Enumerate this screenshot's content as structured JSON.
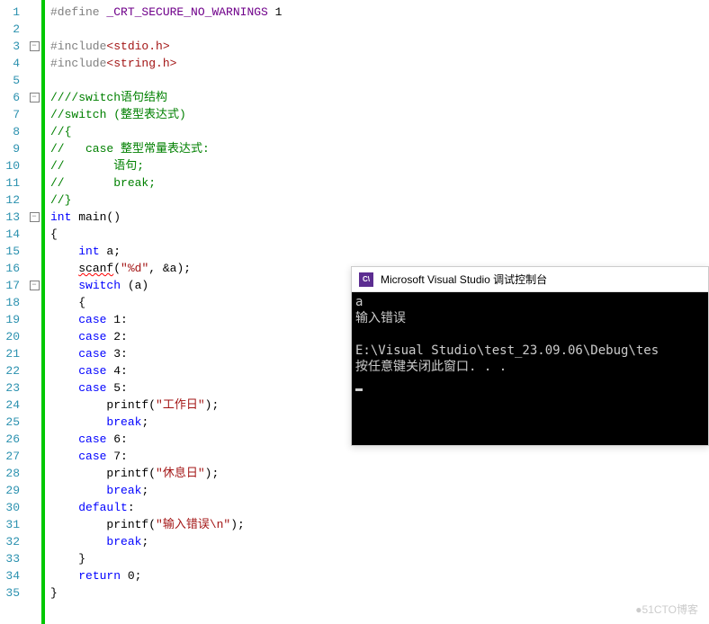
{
  "editor": {
    "lines": [
      {
        "n": 1,
        "fold": "",
        "tokens": [
          {
            "t": "#define ",
            "c": "pp"
          },
          {
            "t": "_CRT_SECURE_NO_WARNINGS",
            "c": "mac"
          },
          {
            "t": " 1",
            "c": "def"
          }
        ]
      },
      {
        "n": 2,
        "fold": "",
        "tokens": []
      },
      {
        "n": 3,
        "fold": "minus",
        "tokens": [
          {
            "t": "#include",
            "c": "pp"
          },
          {
            "t": "<stdio.h>",
            "c": "hdr"
          }
        ]
      },
      {
        "n": 4,
        "fold": "",
        "tokens": [
          {
            "t": "#include",
            "c": "pp"
          },
          {
            "t": "<string.h>",
            "c": "hdr"
          }
        ]
      },
      {
        "n": 5,
        "fold": "",
        "tokens": []
      },
      {
        "n": 6,
        "fold": "minus",
        "tokens": [
          {
            "t": "////switch语句结构",
            "c": "cmt"
          }
        ]
      },
      {
        "n": 7,
        "fold": "",
        "tokens": [
          {
            "t": "//switch (整型表达式)",
            "c": "cmt"
          }
        ]
      },
      {
        "n": 8,
        "fold": "",
        "tokens": [
          {
            "t": "//{",
            "c": "cmt"
          }
        ]
      },
      {
        "n": 9,
        "fold": "",
        "tokens": [
          {
            "t": "//   case 整型常量表达式:",
            "c": "cmt"
          }
        ]
      },
      {
        "n": 10,
        "fold": "",
        "tokens": [
          {
            "t": "//       语句;",
            "c": "cmt"
          }
        ]
      },
      {
        "n": 11,
        "fold": "",
        "tokens": [
          {
            "t": "//       break;",
            "c": "cmt"
          }
        ]
      },
      {
        "n": 12,
        "fold": "",
        "tokens": [
          {
            "t": "//}",
            "c": "cmt"
          }
        ]
      },
      {
        "n": 13,
        "fold": "minus",
        "tokens": [
          {
            "t": "int",
            "c": "kw"
          },
          {
            "t": " main()",
            "c": "fn"
          }
        ]
      },
      {
        "n": 14,
        "fold": "",
        "tokens": [
          {
            "t": "{",
            "c": "def"
          }
        ]
      },
      {
        "n": 15,
        "fold": "",
        "tokens": [
          {
            "t": "    ",
            "c": ""
          },
          {
            "t": "int",
            "c": "kw"
          },
          {
            "t": " a;",
            "c": "def"
          }
        ]
      },
      {
        "n": 16,
        "fold": "",
        "tokens": [
          {
            "t": "    ",
            "c": ""
          },
          {
            "t": "scanf",
            "c": "fn wavy"
          },
          {
            "t": "(",
            "c": "def"
          },
          {
            "t": "\"%d\"",
            "c": "str"
          },
          {
            "t": ", &a);",
            "c": "def"
          }
        ]
      },
      {
        "n": 17,
        "fold": "minus",
        "tokens": [
          {
            "t": "    ",
            "c": ""
          },
          {
            "t": "switch",
            "c": "kw"
          },
          {
            "t": " (a)",
            "c": "def"
          }
        ]
      },
      {
        "n": 18,
        "fold": "",
        "tokens": [
          {
            "t": "    {",
            "c": "def"
          }
        ]
      },
      {
        "n": 19,
        "fold": "",
        "tokens": [
          {
            "t": "    ",
            "c": ""
          },
          {
            "t": "case",
            "c": "kw"
          },
          {
            "t": " 1:",
            "c": "def"
          }
        ]
      },
      {
        "n": 20,
        "fold": "",
        "tokens": [
          {
            "t": "    ",
            "c": ""
          },
          {
            "t": "case",
            "c": "kw"
          },
          {
            "t": " 2:",
            "c": "def"
          }
        ]
      },
      {
        "n": 21,
        "fold": "",
        "tokens": [
          {
            "t": "    ",
            "c": ""
          },
          {
            "t": "case",
            "c": "kw"
          },
          {
            "t": " 3:",
            "c": "def"
          }
        ]
      },
      {
        "n": 22,
        "fold": "",
        "tokens": [
          {
            "t": "    ",
            "c": ""
          },
          {
            "t": "case",
            "c": "kw"
          },
          {
            "t": " 4:",
            "c": "def"
          }
        ]
      },
      {
        "n": 23,
        "fold": "",
        "tokens": [
          {
            "t": "    ",
            "c": ""
          },
          {
            "t": "case",
            "c": "kw"
          },
          {
            "t": " 5:",
            "c": "def"
          }
        ]
      },
      {
        "n": 24,
        "fold": "",
        "tokens": [
          {
            "t": "        printf(",
            "c": "def"
          },
          {
            "t": "\"工作日\"",
            "c": "str"
          },
          {
            "t": ");",
            "c": "def"
          }
        ]
      },
      {
        "n": 25,
        "fold": "",
        "tokens": [
          {
            "t": "        ",
            "c": ""
          },
          {
            "t": "break",
            "c": "kw"
          },
          {
            "t": ";",
            "c": "def"
          }
        ]
      },
      {
        "n": 26,
        "fold": "",
        "tokens": [
          {
            "t": "    ",
            "c": ""
          },
          {
            "t": "case",
            "c": "kw"
          },
          {
            "t": " 6:",
            "c": "def"
          }
        ]
      },
      {
        "n": 27,
        "fold": "",
        "tokens": [
          {
            "t": "    ",
            "c": ""
          },
          {
            "t": "case",
            "c": "kw"
          },
          {
            "t": " 7:",
            "c": "def"
          }
        ]
      },
      {
        "n": 28,
        "fold": "",
        "tokens": [
          {
            "t": "        printf(",
            "c": "def"
          },
          {
            "t": "\"休息日\"",
            "c": "str"
          },
          {
            "t": ");",
            "c": "def"
          }
        ]
      },
      {
        "n": 29,
        "fold": "",
        "tokens": [
          {
            "t": "        ",
            "c": ""
          },
          {
            "t": "break",
            "c": "kw"
          },
          {
            "t": ";",
            "c": "def"
          }
        ]
      },
      {
        "n": 30,
        "fold": "",
        "tokens": [
          {
            "t": "    ",
            "c": ""
          },
          {
            "t": "default",
            "c": "kw"
          },
          {
            "t": ":",
            "c": "def"
          }
        ]
      },
      {
        "n": 31,
        "fold": "",
        "tokens": [
          {
            "t": "        printf(",
            "c": "def"
          },
          {
            "t": "\"输入错误\\n\"",
            "c": "str"
          },
          {
            "t": ");",
            "c": "def"
          }
        ]
      },
      {
        "n": 32,
        "fold": "",
        "tokens": [
          {
            "t": "        ",
            "c": ""
          },
          {
            "t": "break",
            "c": "kw"
          },
          {
            "t": ";",
            "c": "def"
          }
        ]
      },
      {
        "n": 33,
        "fold": "",
        "tokens": [
          {
            "t": "    }",
            "c": "def"
          }
        ]
      },
      {
        "n": 34,
        "fold": "",
        "tokens": [
          {
            "t": "    ",
            "c": ""
          },
          {
            "t": "return",
            "c": "kw"
          },
          {
            "t": " 0;",
            "c": "def"
          }
        ]
      },
      {
        "n": 35,
        "fold": "",
        "tokens": [
          {
            "t": "}",
            "c": "def"
          }
        ]
      }
    ]
  },
  "console": {
    "icon": "C\\",
    "title": "Microsoft Visual Studio 调试控制台",
    "body": "a\n输入错误\n\nE:\\Visual Studio\\test_23.09.06\\Debug\\tes\n按任意键关闭此窗口. . ."
  },
  "watermark": "●51CTO博客"
}
